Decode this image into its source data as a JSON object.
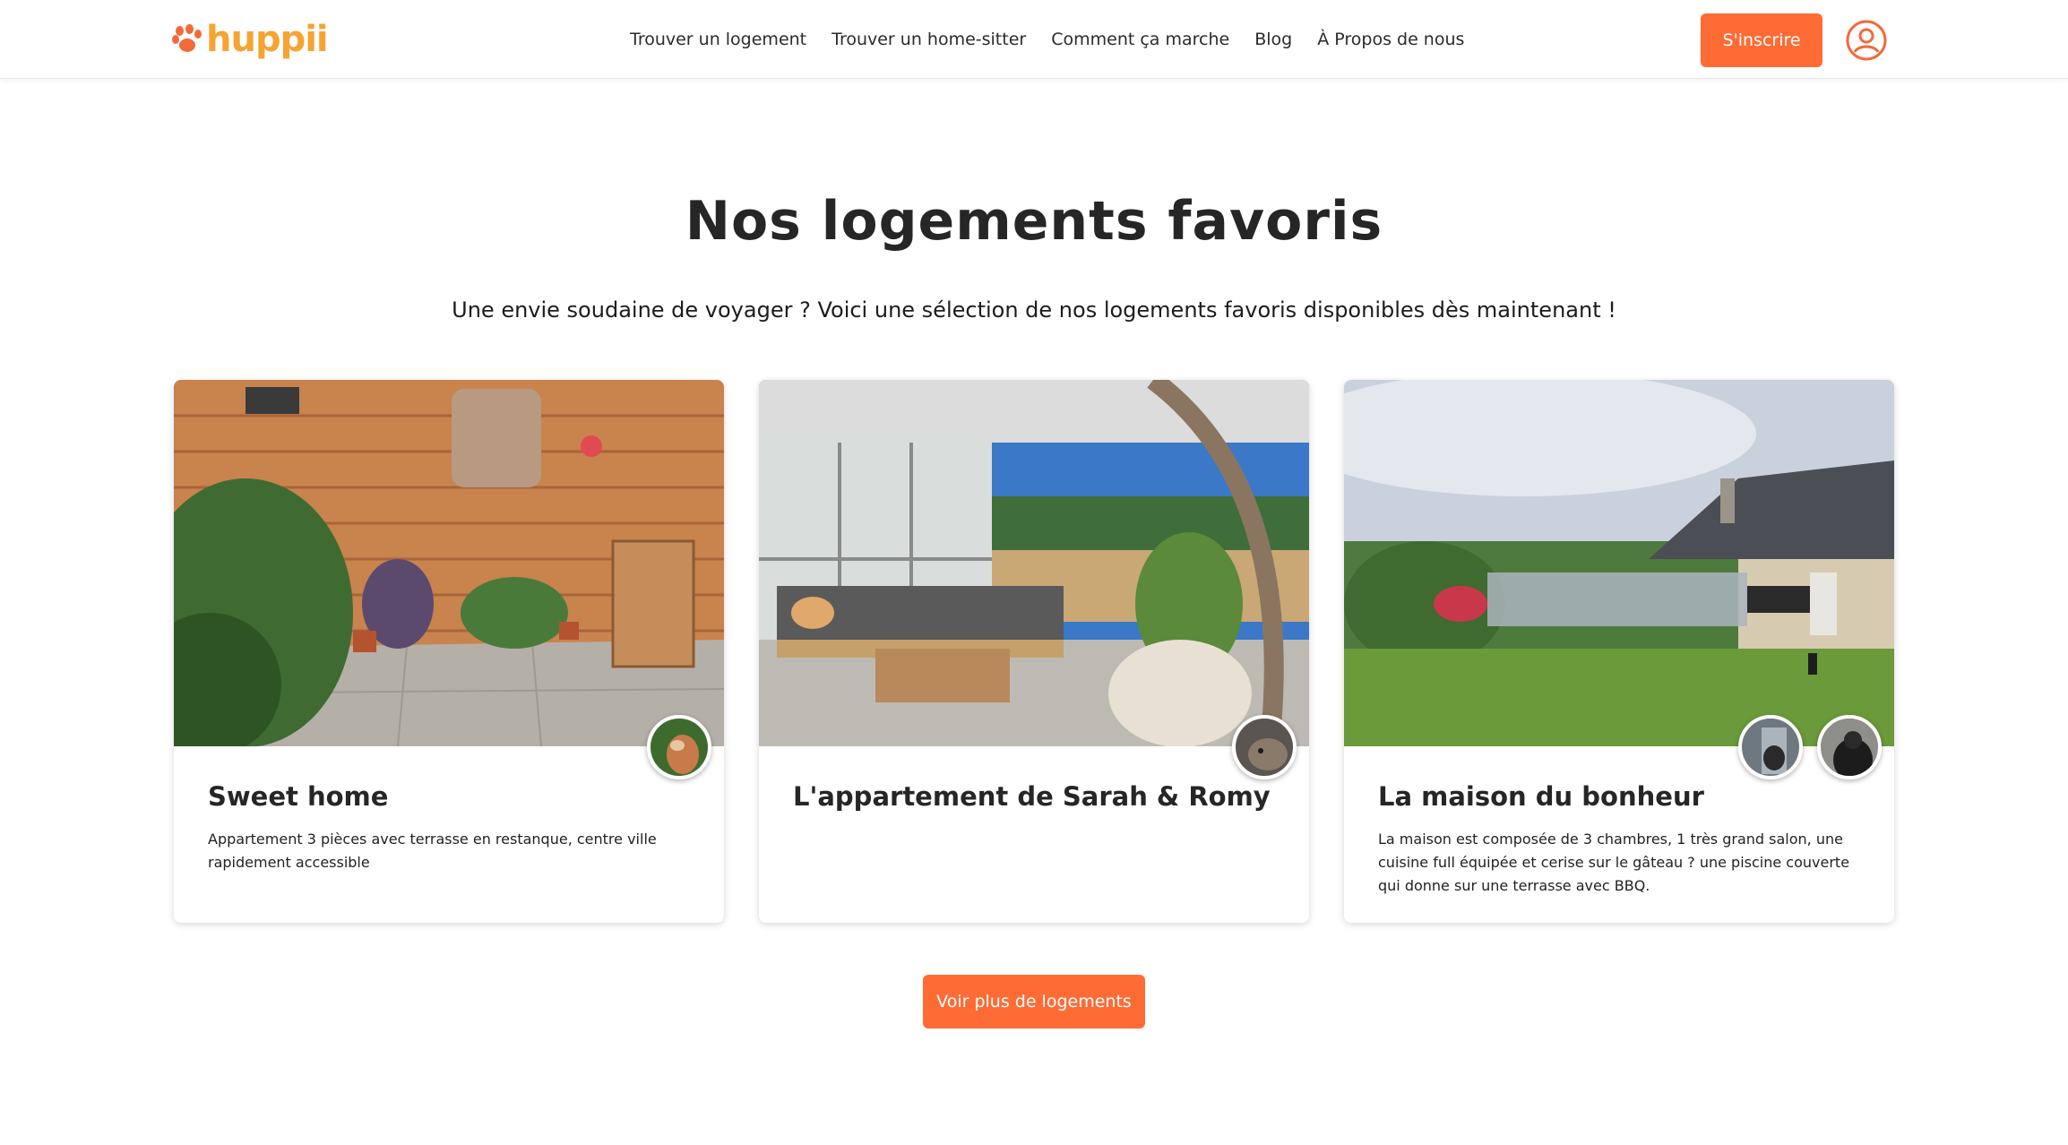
{
  "header": {
    "logo_text": "huppii",
    "nav": [
      {
        "label": "Trouver un logement"
      },
      {
        "label": "Trouver un home-sitter"
      },
      {
        "label": "Comment ça marche"
      },
      {
        "label": "Blog"
      },
      {
        "label": "À Propos de nous"
      }
    ],
    "signup_label": "S'inscrire",
    "user_icon": "user-circle-icon"
  },
  "section": {
    "title": "Nos logements favoris",
    "subtitle": "Une envie soudaine de voyager ? Voici une sélection de nos logements favoris disponibles dès maintenant !"
  },
  "cards": [
    {
      "title": "Sweet home",
      "description": "Appartement 3 pièces avec terrasse en restanque, centre ville rapidement accessible"
    },
    {
      "title": "L'appartement de Sarah & Romy",
      "description": ""
    },
    {
      "title": "La maison du bonheur",
      "description": "La maison est composée de 3 chambres, 1 très grand salon, une cuisine full équipée et cerise sur le gâteau ? une piscine couverte qui donne sur une terrasse avec BBQ."
    }
  ],
  "more_button_label": "Voir plus de logements",
  "colors": {
    "accent": "#ff6b35",
    "logo_yellow": "#f6a431",
    "logo_paw": "#f26a3a"
  }
}
